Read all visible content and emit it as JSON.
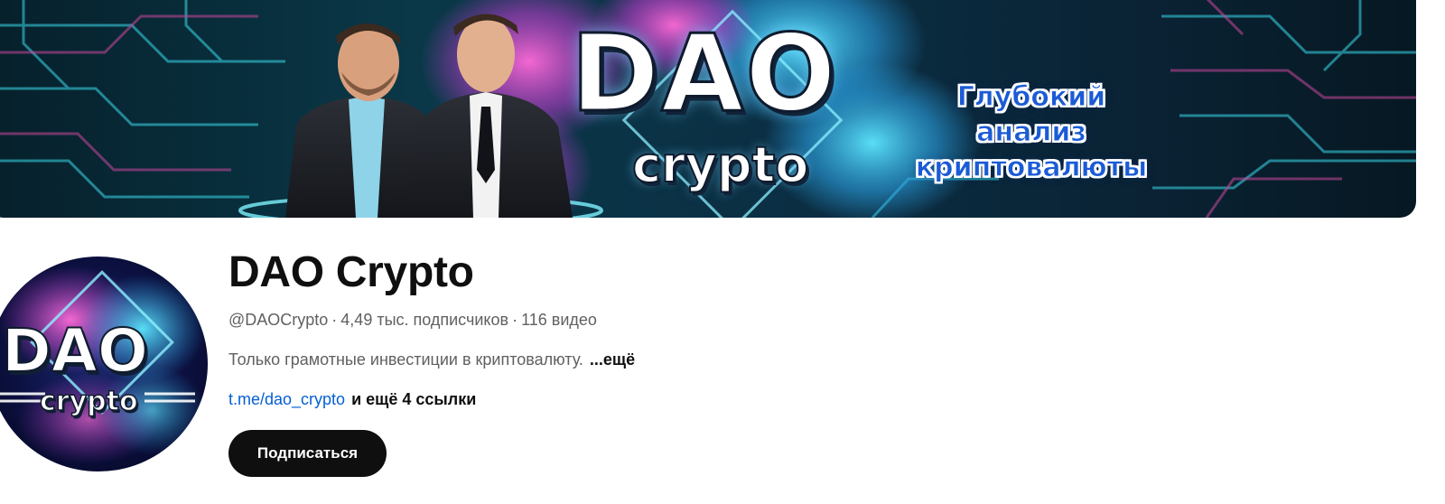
{
  "banner": {
    "logo_main": "DAO",
    "logo_sub": "crypto",
    "tagline_lines": [
      "Глубокий",
      "анализ",
      "криптовалюты"
    ]
  },
  "avatar": {
    "logo_main": "DAO",
    "logo_sub": "crypto"
  },
  "channel": {
    "title": "DAO Crypto",
    "handle": "@DAOCrypto",
    "subscribers": "4,49 тыс. подписчиков",
    "videos": "116 видео",
    "separator": "·",
    "description": "Только грамотные инвестиции в криптовалюту.",
    "more_label": "...ещё",
    "primary_link": "t.me/dao_crypto",
    "other_links": "и ещё 4 ссылки",
    "subscribe_label": "Подписаться"
  },
  "colors": {
    "title_text": "#0f0f0f",
    "secondary_text": "#606060",
    "link_blue": "#065fd4",
    "button_bg": "#0f0f0f",
    "button_text": "#ffffff",
    "banner_cyan": "#2fd3e6",
    "banner_pink": "#e23fb0",
    "tagline_blue": "#1b5bd6"
  },
  "icons": [
    "banner-image",
    "channel-avatar"
  ]
}
